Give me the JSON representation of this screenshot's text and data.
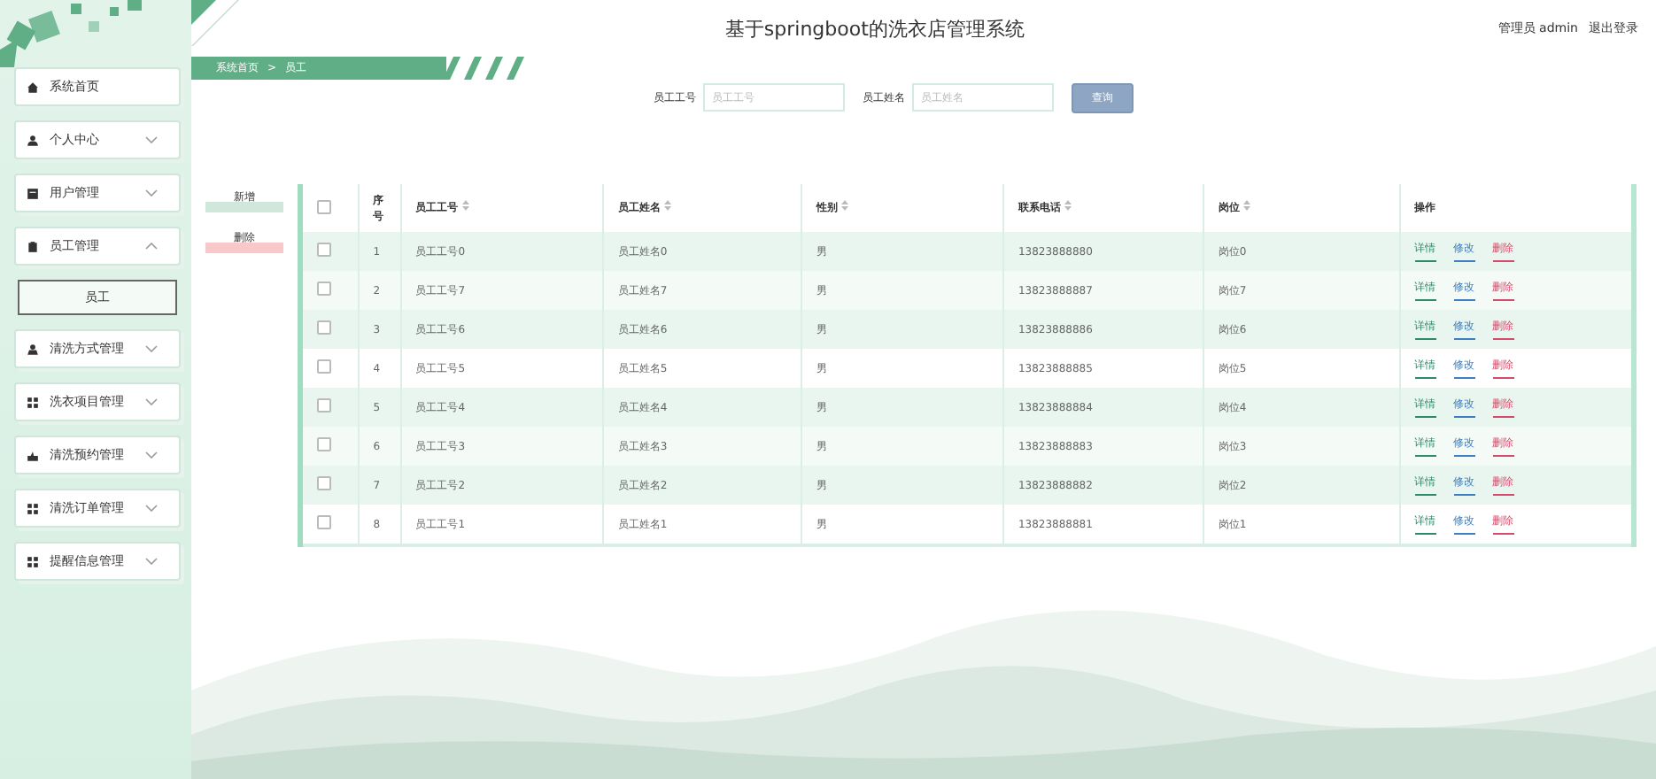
{
  "header": {
    "title": "基于springboot的洗衣店管理系统",
    "user": "管理员 admin",
    "logout": "退出登录"
  },
  "breadcrumb": {
    "home": "系统首页",
    "separator": ">",
    "current": "员工"
  },
  "sidebar": {
    "items": [
      {
        "kind": "item",
        "label": "系统首页"
      },
      {
        "kind": "group",
        "label": "个人中心",
        "expanded": false
      },
      {
        "kind": "group",
        "label": "用户管理",
        "expanded": false
      },
      {
        "kind": "group",
        "label": "员工管理",
        "expanded": true,
        "children": [
          {
            "label": "员工",
            "selected": true
          }
        ]
      },
      {
        "kind": "group",
        "label": "清洗方式管理",
        "expanded": false
      },
      {
        "kind": "group",
        "label": "洗衣项目管理",
        "expanded": false
      },
      {
        "kind": "group",
        "label": "清洗预约管理",
        "expanded": false
      },
      {
        "kind": "group",
        "label": "清洗订单管理",
        "expanded": false
      },
      {
        "kind": "group",
        "label": "提醒信息管理",
        "expanded": false
      }
    ]
  },
  "search": {
    "fields": [
      {
        "label": "员工工号",
        "placeholder": "员工工号"
      },
      {
        "label": "员工姓名",
        "placeholder": "员工姓名"
      }
    ],
    "button": "查询"
  },
  "actions": [
    {
      "kind": "add",
      "label": "新增"
    },
    {
      "kind": "delete",
      "label": "删除"
    }
  ],
  "table": {
    "select_all_checked": false,
    "columns": [
      {
        "label": "序号",
        "sortable": false
      },
      {
        "label": "员工工号",
        "sortable": true
      },
      {
        "label": "员工姓名",
        "sortable": true
      },
      {
        "label": "性别",
        "sortable": true
      },
      {
        "label": "联系电话",
        "sortable": true
      },
      {
        "label": "岗位",
        "sortable": true
      },
      {
        "label": "操作",
        "sortable": false
      }
    ],
    "rows": [
      {
        "checked": false,
        "cells": [
          "1",
          "员工工号0",
          "员工姓名0",
          "男",
          "13823888880",
          "岗位0"
        ],
        "actions": [
          {
            "kind": "detail",
            "label": "详情"
          },
          {
            "kind": "edit",
            "label": "修改"
          },
          {
            "kind": "delete",
            "label": "删除"
          }
        ]
      },
      {
        "checked": false,
        "cells": [
          "2",
          "员工工号7",
          "员工姓名7",
          "男",
          "13823888887",
          "岗位7"
        ],
        "actions": [
          {
            "kind": "detail",
            "label": "详情"
          },
          {
            "kind": "edit",
            "label": "修改"
          },
          {
            "kind": "delete",
            "label": "删除"
          }
        ]
      },
      {
        "checked": false,
        "cells": [
          "3",
          "员工工号6",
          "员工姓名6",
          "男",
          "13823888886",
          "岗位6"
        ],
        "actions": [
          {
            "kind": "detail",
            "label": "详情"
          },
          {
            "kind": "edit",
            "label": "修改"
          },
          {
            "kind": "delete",
            "label": "删除"
          }
        ]
      },
      {
        "checked": false,
        "cells": [
          "4",
          "员工工号5",
          "员工姓名5",
          "男",
          "13823888885",
          "岗位5"
        ],
        "actions": [
          {
            "kind": "detail",
            "label": "详情"
          },
          {
            "kind": "edit",
            "label": "修改"
          },
          {
            "kind": "delete",
            "label": "删除"
          }
        ]
      },
      {
        "checked": false,
        "cells": [
          "5",
          "员工工号4",
          "员工姓名4",
          "男",
          "13823888884",
          "岗位4"
        ],
        "actions": [
          {
            "kind": "detail",
            "label": "详情"
          },
          {
            "kind": "edit",
            "label": "修改"
          },
          {
            "kind": "delete",
            "label": "删除"
          }
        ]
      },
      {
        "checked": false,
        "cells": [
          "6",
          "员工工号3",
          "员工姓名3",
          "男",
          "13823888883",
          "岗位3"
        ],
        "actions": [
          {
            "kind": "detail",
            "label": "详情"
          },
          {
            "kind": "edit",
            "label": "修改"
          },
          {
            "kind": "delete",
            "label": "删除"
          }
        ]
      },
      {
        "checked": false,
        "cells": [
          "7",
          "员工工号2",
          "员工姓名2",
          "男",
          "13823888882",
          "岗位2"
        ],
        "actions": [
          {
            "kind": "detail",
            "label": "详情"
          },
          {
            "kind": "edit",
            "label": "修改"
          },
          {
            "kind": "delete",
            "label": "删除"
          }
        ]
      },
      {
        "checked": false,
        "cells": [
          "8",
          "员工工号1",
          "员工姓名1",
          "男",
          "13823888881",
          "岗位1"
        ],
        "actions": [
          {
            "kind": "detail",
            "label": "详情"
          },
          {
            "kind": "edit",
            "label": "修改"
          },
          {
            "kind": "delete",
            "label": "删除"
          }
        ]
      }
    ]
  }
}
